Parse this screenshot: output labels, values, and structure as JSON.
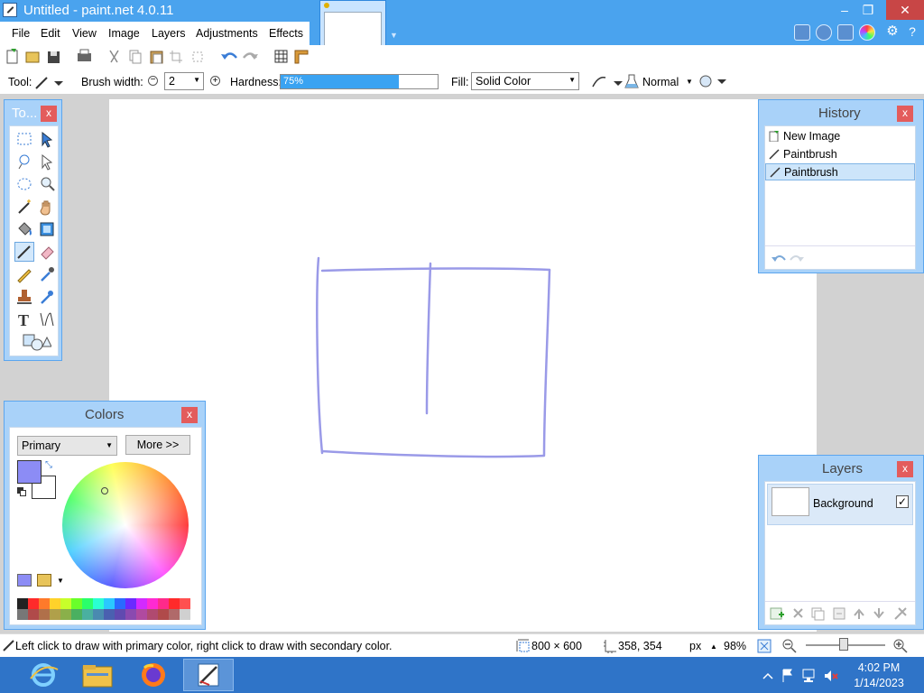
{
  "window": {
    "title": "Untitled - paint.net 4.0.11",
    "minimize": "–",
    "restore": "❐",
    "close": "✕"
  },
  "menu": {
    "items": [
      "File",
      "Edit",
      "View",
      "Image",
      "Layers",
      "Adjustments",
      "Effects"
    ]
  },
  "toolbar": {
    "tool_label": "Tool:",
    "brush_width_label": "Brush width:",
    "brush_width_value": "2",
    "hardness_label": "Hardness:",
    "hardness_value": "75%",
    "hardness_fraction": 0.75,
    "fill_label": "Fill:",
    "fill_value": "Solid Color",
    "blend_mode": "Normal",
    "icons": [
      "new-icon",
      "open-icon",
      "save-icon",
      "print-icon",
      "cut-icon",
      "copy-icon",
      "paste-icon",
      "crop-icon",
      "deselect-icon",
      "undo-icon",
      "redo-icon",
      "grid-icon",
      "ruler-icon"
    ]
  },
  "tools_panel": {
    "title": "To...",
    "close": "x"
  },
  "history_panel": {
    "title": "History",
    "close": "x",
    "items": [
      "New Image",
      "Paintbrush",
      "Paintbrush"
    ],
    "selected_index": 2
  },
  "colors_panel": {
    "title": "Colors",
    "close": "x",
    "mode": "Primary",
    "more_button": "More >>",
    "primary_color": "#8c8cf5",
    "secondary_color": "#ffffff",
    "palette": [
      "#222222",
      "#ff2a2a",
      "#ff7a2a",
      "#ffd22a",
      "#c8ff2a",
      "#6aff2a",
      "#2aff6a",
      "#2affd2",
      "#2ac8ff",
      "#2a6aff",
      "#6a2aff",
      "#d22aff",
      "#ff2ad2",
      "#ff2a8a",
      "#ff2a2a",
      "#ff5050",
      "#777777",
      "#b04a4a",
      "#b0704a",
      "#b0a04a",
      "#8ab04a",
      "#4ab060",
      "#4ab0a0",
      "#4a8ab0",
      "#4a60b0",
      "#604ab0",
      "#8a4ab0",
      "#b04aa0",
      "#b04a70",
      "#b04a4a",
      "#b06a6a",
      "#d0d0d0"
    ]
  },
  "layers_panel": {
    "title": "Layers",
    "close": "x",
    "layer_name": "Background",
    "visible_mark": "✓"
  },
  "status": {
    "hint": "Left click to draw with primary color, right click to draw with secondary color.",
    "image_size": "800 × 600",
    "cursor_pos": "358, 354",
    "units": "px",
    "zoom": "98%"
  },
  "taskbar": {
    "time": "4:02 PM",
    "date": "1/14/2023"
  },
  "colors": {
    "title_bar": "#4aa3ee",
    "panel": "#a9d2f9",
    "stroke": "#9a9ae8",
    "taskbar": "#2f74c8"
  }
}
